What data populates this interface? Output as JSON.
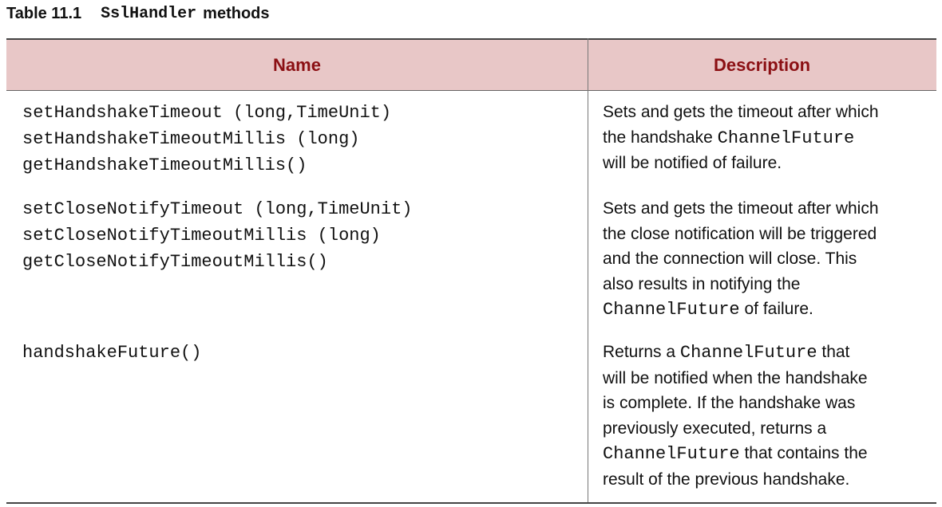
{
  "caption": {
    "number": "Table 11.1",
    "class_name": "SslHandler",
    "suffix": "methods"
  },
  "table": {
    "headers": {
      "name": "Name",
      "description": "Description"
    },
    "rows": [
      {
        "methods": [
          "setHandshakeTimeout (long,TimeUnit)",
          "setHandshakeTimeoutMillis (long)",
          "getHandshakeTimeoutMillis()"
        ],
        "description": {
          "lines": [
            [
              "Sets and gets the timeout after which"
            ],
            [
              "the handshake ",
              "ChannelFuture"
            ],
            [
              "will be notified of failure."
            ]
          ]
        }
      },
      {
        "methods": [
          "setCloseNotifyTimeout (long,TimeUnit)",
          "setCloseNotifyTimeoutMillis (long)",
          "getCloseNotifyTimeoutMillis()"
        ],
        "description": {
          "lines": [
            [
              "Sets and gets the timeout after which"
            ],
            [
              "the close notification will be triggered"
            ],
            [
              "and the connection will close. This"
            ],
            [
              "also results in notifying the"
            ],
            [
              "",
              "ChannelFuture",
              " of failure."
            ]
          ]
        }
      },
      {
        "methods": [
          "handshakeFuture()"
        ],
        "description": {
          "lines": [
            [
              "Returns a ",
              "ChannelFuture",
              " that"
            ],
            [
              "will be notified when the handshake"
            ],
            [
              "is complete. If the handshake was"
            ],
            [
              "previously executed, returns a"
            ],
            [
              "",
              "ChannelFuture",
              " that contains the"
            ],
            [
              "result of the previous handshake."
            ]
          ]
        }
      }
    ]
  }
}
